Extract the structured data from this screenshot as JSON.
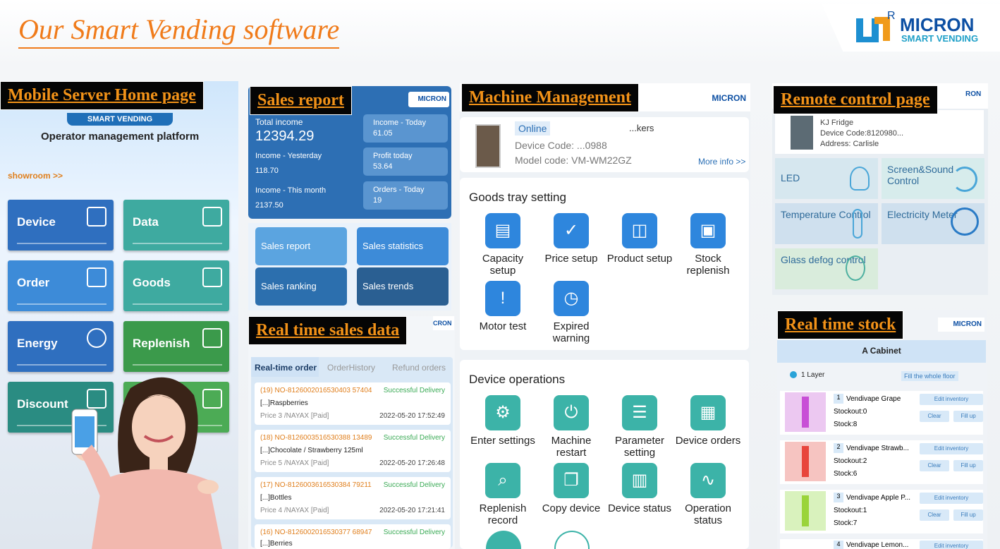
{
  "header": {
    "title": "Our Smart Vending software",
    "brand": "MICRON",
    "brand_sub": "SMART VENDING",
    "reg": "R"
  },
  "labels": {
    "home": "Mobile Server Home page",
    "sales": "Sales report",
    "machine": "Machine Management",
    "remote": "Remote control page",
    "realtime_sales": "Real time sales data",
    "realtime_stock": "Real time stock"
  },
  "home": {
    "logo_sub": "SMART VENDING",
    "platform": "Operator management platform",
    "showroom": "showroom >>",
    "tiles": [
      "Device",
      "Data",
      "Order",
      "Goods",
      "Energy",
      "Replenish",
      "Discount"
    ]
  },
  "sales": {
    "brand": "MICRON",
    "total_label": "Total income",
    "total_value": "12394.29",
    "yesterday_label": "Income - Yesterday",
    "yesterday_value": "118.70",
    "month_label": "Income - This month",
    "month_value": "2137.50",
    "today_label": "Income - Today",
    "today_value": "61.05",
    "profit_label": "Profit today",
    "profit_value": "53.64",
    "orders_label": "Orders - Today",
    "orders_value": "19",
    "buttons": [
      "Sales report",
      "Sales statistics",
      "Sales ranking",
      "Sales trends"
    ]
  },
  "realtime": {
    "brand": "CRON",
    "tabs": [
      "Real-time order",
      "OrderHistory",
      "Refund orders"
    ],
    "orders": [
      {
        "no": "(19) NO-8126002016530403 57404",
        "status": "Successful Delivery",
        "item": "[...]Raspberries",
        "price": "Price 3 /NAYAX [Paid]",
        "time": "2022-05-20 17:52:49"
      },
      {
        "no": "(18) NO-8126003516530388 13489",
        "status": "Successful Delivery",
        "item": "[...]Chocolate / Strawberry 125ml",
        "price": "Price 5 /NAYAX [Paid]",
        "time": "2022-05-20 17:26:48"
      },
      {
        "no": "(17) NO-8126003616530384 79211",
        "status": "Successful Delivery",
        "item": "[...]Bottles",
        "price": "Price 4 /NAYAX [Paid]",
        "time": "2022-05-20 17:21:41"
      },
      {
        "no": "(16) NO-8126002016530377 68947",
        "status": "Successful Delivery",
        "item": "[...]Berries",
        "price": "",
        "time": ""
      }
    ]
  },
  "machine": {
    "brand": "MICRON",
    "online": "Online",
    "name_tail": "...kers",
    "device_code": "Device Code: ...0988",
    "model_code": "Model code: VM-WM22GZ",
    "more": "More info >>",
    "tray_title": "Goods tray setting",
    "tray_items": [
      "Capacity setup",
      "Price setup",
      "Product setup",
      "Stock replenish",
      "Motor test",
      "Expired warning"
    ],
    "ops_title": "Device operations",
    "ops_items": [
      "Enter settings",
      "Machine restart",
      "Parameter setting",
      "Device orders",
      "Replenish record",
      "Copy device",
      "Device status",
      "Operation status"
    ]
  },
  "remote": {
    "brand": "RON",
    "fridge": "KJ Fridge",
    "device_code": "Device Code:8120980...",
    "address": "Address: Carlisle",
    "tiles": [
      "LED",
      "Screen&Sound Control",
      "Temperature Control",
      "Electricity Meter",
      "Glass defog control"
    ]
  },
  "stock": {
    "brand": "MICRON",
    "cabinet": "A Cabinet",
    "layer": "1 Layer",
    "fill_floor": "Fill the whole floor",
    "edit": "Edit inventory",
    "clear": "Clear",
    "fill": "Fill up",
    "items": [
      {
        "idx": "1",
        "name": "Vendivape Grape",
        "stockout": "Stockout:0",
        "stock": "Stock:8",
        "color": "#c84fd6"
      },
      {
        "idx": "2",
        "name": "Vendivape Strawb...",
        "stockout": "Stockout:2",
        "stock": "Stock:6",
        "color": "#e8453c"
      },
      {
        "idx": "3",
        "name": "Vendivape Apple P...",
        "stockout": "Stockout:1",
        "stock": "Stock:7",
        "color": "#9ad43a"
      },
      {
        "idx": "4",
        "name": "Vendivape Lemon...",
        "stockout": "",
        "stock": "",
        "color": "#2f7bd6"
      }
    ]
  }
}
